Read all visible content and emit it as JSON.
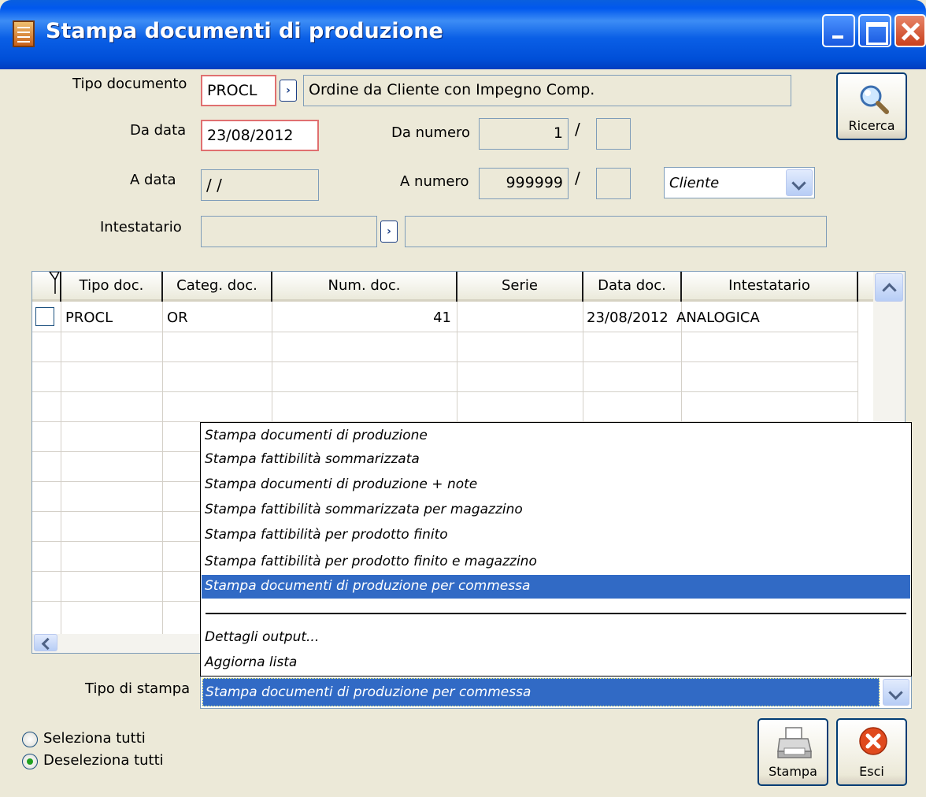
{
  "window": {
    "title": "Stampa documenti di produzione"
  },
  "form": {
    "tipo_documento": {
      "label": "Tipo documento",
      "code": "PROCL",
      "description": "Ordine da Cliente con Impegno Comp."
    },
    "da_data": {
      "label": "Da data",
      "value": "23/08/2012"
    },
    "da_numero": {
      "label": "Da numero",
      "value": "1",
      "serie": ""
    },
    "a_data": {
      "label": "A data",
      "value": " /  /"
    },
    "a_numero": {
      "label": "A numero",
      "value": "999999",
      "serie": ""
    },
    "tipo_intestatario": {
      "value": "Cliente"
    },
    "intestatario": {
      "label": "Intestatario",
      "code": "",
      "description": ""
    },
    "slash": "/"
  },
  "buttons": {
    "ricerca": "Ricerca",
    "stampa": "Stampa",
    "esci": "Esci"
  },
  "grid": {
    "columns": [
      "Tipo doc.",
      "Categ. doc.",
      "Num. doc.",
      "Serie",
      "Data doc.",
      "Intestatario"
    ],
    "rows": [
      {
        "tipo": "PROCL",
        "categ": "OR",
        "num": "41",
        "serie": "",
        "data": "23/08/2012",
        "intestatario": "ANALOGICA"
      }
    ]
  },
  "tipo_stampa": {
    "label": "Tipo di stampa",
    "selected": "Stampa documenti di produzione per commessa",
    "options": [
      "Stampa documenti di produzione",
      "Stampa fattibilità sommarizzata",
      "Stampa documenti di produzione + note",
      "Stampa fattibilità sommarizzata per magazzino",
      "Stampa fattibilità  per prodotto finito",
      "Stampa fattibilità per prodotto finito e magazzino",
      "Stampa documenti di produzione per commessa"
    ],
    "extra_options": [
      "Dettagli output...",
      "Aggiorna lista"
    ]
  },
  "selection": {
    "seleziona_tutti": "Seleziona tutti",
    "deseleziona_tutti": "Deseleziona tutti",
    "checked": "deseleziona_tutti"
  },
  "icons": [
    "app-doc-icon",
    "minimize-icon",
    "maximize-icon",
    "close-icon",
    "magnifier-icon",
    "zoom-arrow-icon",
    "chevron-down-icon",
    "printer-icon",
    "cancel-x-icon",
    "filter-icon"
  ]
}
